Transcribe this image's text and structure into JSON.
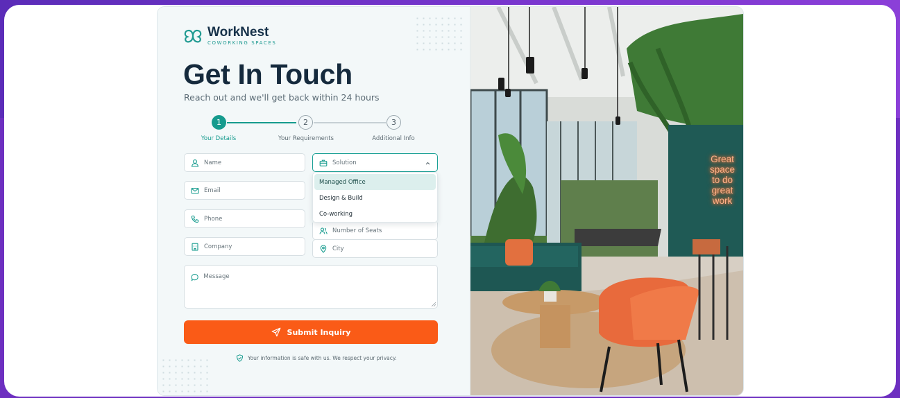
{
  "brand": {
    "name": "WorkNest",
    "tagline": "COWORKING SPACES"
  },
  "heading": {
    "title": "Get In Touch",
    "subtitle": "Reach out and we'll get back within 24 hours"
  },
  "stepper": {
    "steps": [
      {
        "number": "1",
        "label": "Your Details",
        "active": true
      },
      {
        "number": "2",
        "label": "Your Requirements",
        "active": false
      },
      {
        "number": "3",
        "label": "Additional Info",
        "active": false
      }
    ]
  },
  "form": {
    "name_placeholder": "Name",
    "email_placeholder": "Email",
    "phone_placeholder": "Phone",
    "company_placeholder": "Company",
    "solution_placeholder": "Solution",
    "seats_placeholder": "Number of Seats",
    "city_placeholder": "City",
    "message_placeholder": "Message",
    "solution_options": [
      "Managed Office",
      "Design & Build",
      "Co-working"
    ],
    "solution_highlighted": "Managed Office",
    "submit_label": "Submit Inquiry",
    "privacy_note": "Your information is safe with us. We respect your privacy."
  },
  "photo": {
    "neon_sign": "Great space to do great work"
  },
  "colors": {
    "accent_teal": "#169b8e",
    "submit_orange": "#fa5b17",
    "heading_navy": "#152a3d",
    "frame_purple": "#6d2fc0"
  }
}
